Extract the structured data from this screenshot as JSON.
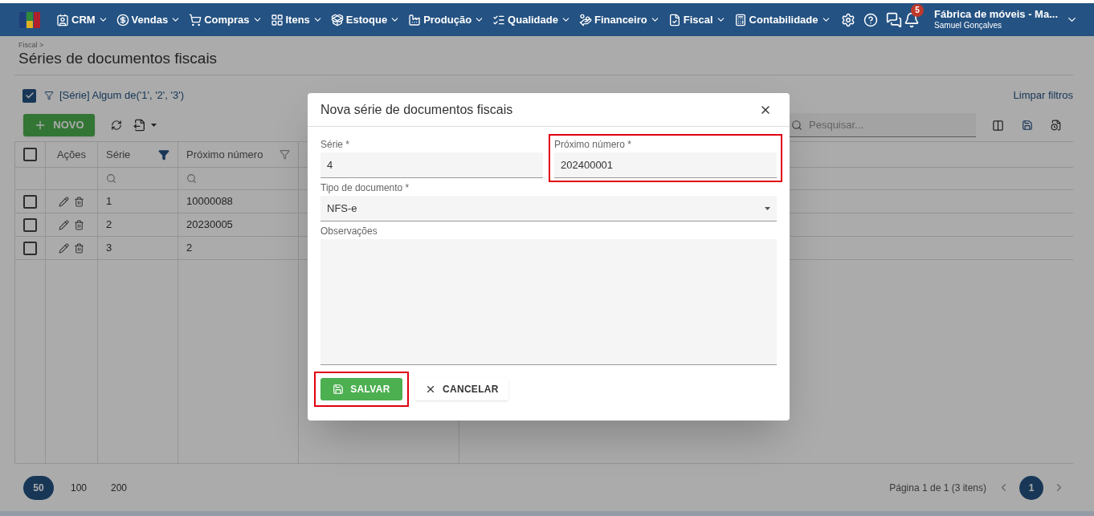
{
  "navbar": {
    "menus": [
      "CRM",
      "Vendas",
      "Compras",
      "Itens",
      "Estoque",
      "Produção",
      "Qualidade",
      "Financeiro",
      "Fiscal",
      "Contabilidade"
    ],
    "notifications": "5",
    "company": "Fábrica de móveis - Ma...",
    "user": "Samuel Gonçalves"
  },
  "breadcrumb": "Fiscal >",
  "page_title": "Séries de documentos fiscais",
  "filter": {
    "checked": true,
    "text": "[Série] Algum de('1', '2', '3')",
    "clear": "Limpar filtros"
  },
  "toolbar": {
    "new_button": "NOVO",
    "search": {
      "placeholder": "Pesquisar..."
    }
  },
  "table": {
    "all_checked": false,
    "columns": [
      {
        "label": "Ações",
        "filterable": false
      },
      {
        "label": "Série",
        "filterable": true,
        "filtered": true
      },
      {
        "label": "Próximo número",
        "filterable": true,
        "filtered": false
      }
    ],
    "rows": [
      {
        "checked": false,
        "serie": "1",
        "next": "10000088"
      },
      {
        "checked": false,
        "serie": "2",
        "next": "20230005"
      },
      {
        "checked": false,
        "serie": "3",
        "next": "2"
      }
    ]
  },
  "pagination": {
    "sizes": [
      {
        "label": "50",
        "selected": true
      },
      {
        "label": "100",
        "selected": false
      },
      {
        "label": "200",
        "selected": false
      }
    ],
    "info": "Página 1 de 1 (3 itens)",
    "pages": [
      {
        "label": "1",
        "selected": true
      }
    ]
  },
  "dialog": {
    "title": "Nova série de documentos fiscais",
    "fields": [
      {
        "kind": "text",
        "label": "Série *",
        "value": "4",
        "highlighted": false
      },
      {
        "kind": "text",
        "label": "Próximo número *",
        "value": "202400001",
        "highlighted": true
      },
      {
        "kind": "select",
        "label": "Tipo de documento *",
        "value": "NFS-e",
        "highlighted": false
      },
      {
        "kind": "textarea",
        "label": "Observações",
        "highlighted": false
      }
    ],
    "buttons": [
      {
        "kind": "primary",
        "label": "SALVAR",
        "highlighted": true
      },
      {
        "kind": "secondary",
        "label": "CANCELAR",
        "highlighted": false
      }
    ]
  }
}
